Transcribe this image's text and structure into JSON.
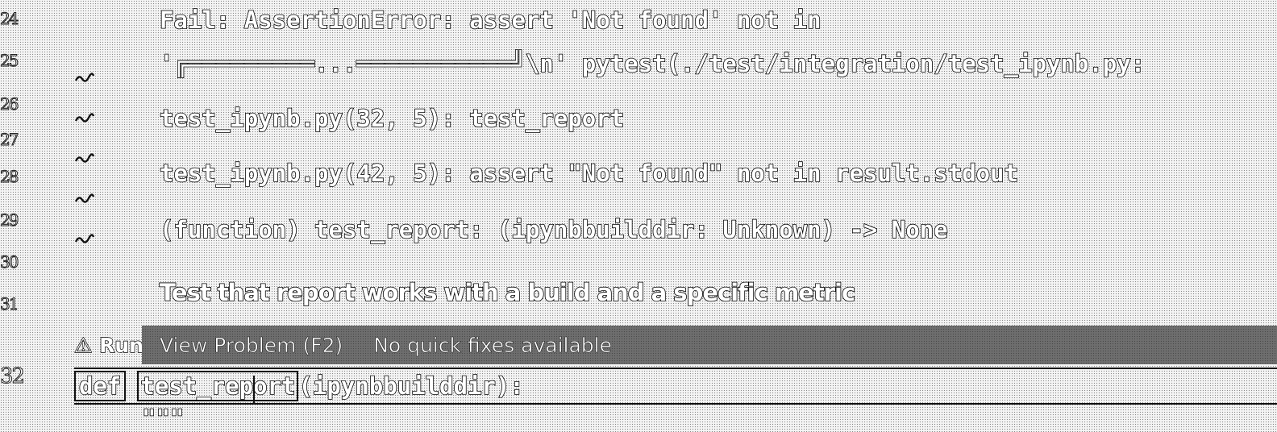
{
  "gutter": {
    "line_numbers": [
      "24",
      "25",
      "26",
      "27",
      "28",
      "29",
      "30",
      "31",
      "32"
    ]
  },
  "hover": {
    "fail_line1": "Fail: AssertionError: assert 'Not found' not in",
    "fail_line2_prefix": "'",
    "fail_line2_box": "╔═════════...═══════════╝",
    "fail_line2_suffix": "\\n' pytest(./test/integration/test_ipynb.py:",
    "frame1": "test_ipynb.py(32, 5): test_report",
    "frame2": "test_ipynb.py(42, 5): assert \"Not found\" not in result.stdout",
    "signature": "(function) test_report: (ipynbbuilddir: Unknown) -> None",
    "docstring": "Test that report works with a build and a specific metric"
  },
  "status": {
    "run_label": "⚠ Run",
    "view_problem": "View Problem (F2)",
    "no_fixes": "No quick fixes available"
  },
  "code": {
    "keyword": "def",
    "function_name": "test_report",
    "args": "(ipynbbuilddir):",
    "next_line": "\"\"\""
  },
  "icons": {
    "squiggle": "error-squiggle-icon",
    "warning": "warning-icon"
  }
}
